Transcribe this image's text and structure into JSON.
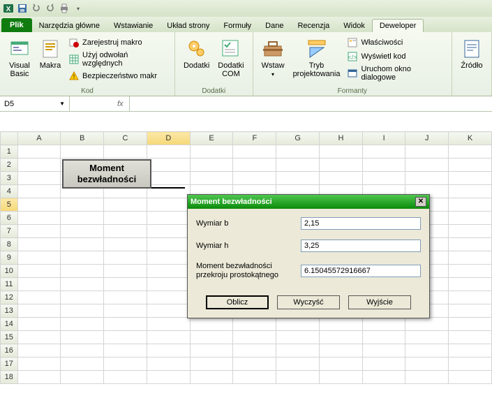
{
  "qat": {
    "excel_icon": "X",
    "save": "💾"
  },
  "tabs": {
    "file": "Plik",
    "items": [
      "Narzędzia główne",
      "Wstawianie",
      "Układ strony",
      "Formuły",
      "Dane",
      "Recenzja",
      "Widok",
      "Deweloper"
    ]
  },
  "ribbon": {
    "kod": {
      "label": "Kod",
      "visual_basic": "Visual\nBasic",
      "makra": "Makra",
      "rec": "Zarejestruj makro",
      "rel": "Użyj odwołań względnych",
      "sec": "Bezpieczeństwo makr"
    },
    "dodatki": {
      "label": "Dodatki",
      "dodatki": "Dodatki",
      "com": "Dodatki\nCOM"
    },
    "formanty": {
      "label": "Formanty",
      "wstaw": "Wstaw",
      "tryb": "Tryb\nprojektowania",
      "props": "Właściwości",
      "code": "Wyświetl kod",
      "dlg": "Uruchom okno dialogowe"
    },
    "xml": {
      "zrodlo": "Źródło"
    }
  },
  "namebox": "D5",
  "columns": [
    "A",
    "B",
    "C",
    "D",
    "E",
    "F",
    "G",
    "H",
    "I",
    "J",
    "K"
  ],
  "rows_count": 18,
  "selected_col": "D",
  "selected_row": 5,
  "sheet_button": {
    "line1": "Moment",
    "line2": "bezwładności"
  },
  "dialog": {
    "title": "Moment bezwładności",
    "wymiar_b_label": "Wymiar b",
    "wymiar_b_value": "2,15",
    "wymiar_h_label": "Wymiar h",
    "wymiar_h_value": "3,25",
    "result_label": "Moment bezwładności przekroju prostokątnego",
    "result_value": "6.15045572916667",
    "btn_oblicz": "Oblicz",
    "btn_wyczysc": "Wyczyść",
    "btn_wyjscie": "Wyjście"
  }
}
